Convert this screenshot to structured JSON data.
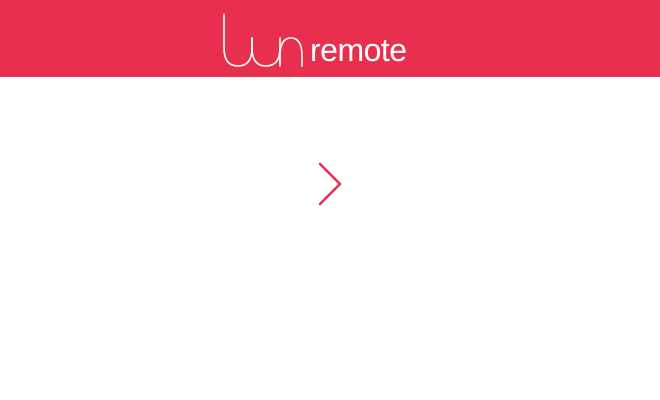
{
  "colors": {
    "brand": "#E8304E",
    "background": "#FFFFFF",
    "header_text": "#FFFFFF"
  },
  "header": {
    "logo": {
      "mark_text": "lun",
      "app_name": "remote"
    }
  },
  "main": {
    "next_button": {
      "icon": "chevron-right-icon"
    }
  }
}
